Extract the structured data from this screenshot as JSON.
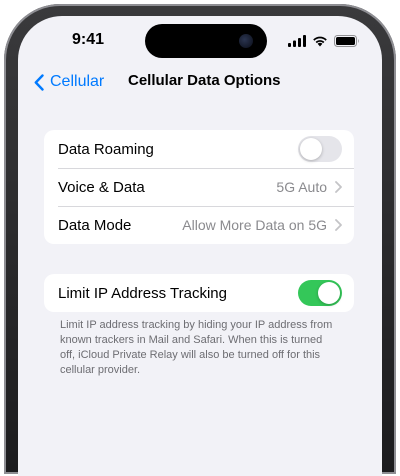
{
  "status_bar": {
    "time": "9:41",
    "icons": [
      "cellular-signal-icon",
      "wifi-icon",
      "battery-icon"
    ]
  },
  "nav": {
    "back_label": "Cellular",
    "title": "Cellular Data Options"
  },
  "settings_group": {
    "rows": [
      {
        "label": "Data Roaming",
        "control": "toggle",
        "toggle_on": false
      },
      {
        "label": "Voice & Data",
        "value": "5G Auto",
        "control": "chevron"
      },
      {
        "label": "Data Mode",
        "value": "Allow More Data on 5G",
        "control": "chevron"
      }
    ]
  },
  "tracking_group": {
    "label": "Limit IP Address Tracking",
    "toggle_on": true,
    "footnote": "Limit IP address tracking by hiding your IP address from known trackers in Mail and Safari. When this is turned off, iCloud Private Relay will also be turned off for this cellular provider."
  },
  "colors": {
    "accent": "#007aff",
    "toggle_on": "#34c759",
    "toggle_off": "#e5e5ea",
    "background": "#f2f2f7"
  }
}
